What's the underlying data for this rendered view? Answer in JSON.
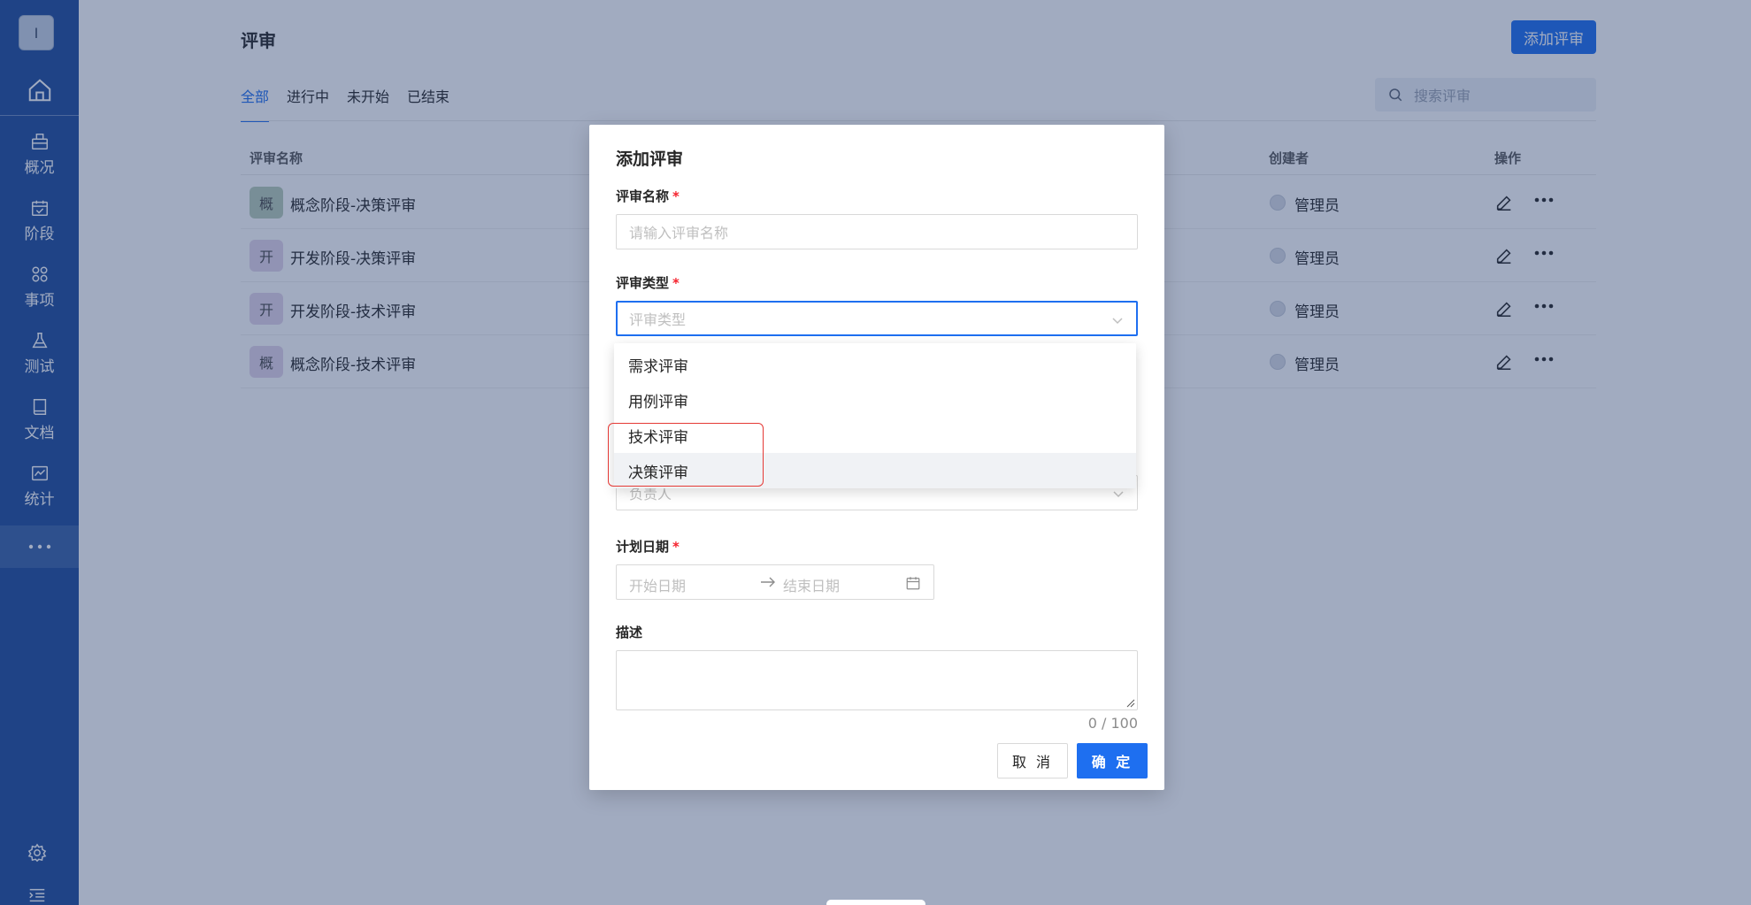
{
  "sidebar": {
    "avatar_text": "I",
    "items": [
      {
        "label": "概况",
        "icon": "briefcase-icon"
      },
      {
        "label": "阶段",
        "icon": "calendar-check-icon"
      },
      {
        "label": "事项",
        "icon": "items-icon"
      },
      {
        "label": "测试",
        "icon": "flask-icon"
      },
      {
        "label": "文档",
        "icon": "book-icon"
      },
      {
        "label": "统计",
        "icon": "chart-icon"
      }
    ]
  },
  "page": {
    "title": "评审",
    "add_button": "添加评审",
    "tabs": [
      {
        "label": "全部",
        "active": true
      },
      {
        "label": "进行中",
        "active": false
      },
      {
        "label": "未开始",
        "active": false
      },
      {
        "label": "已结束",
        "active": false
      }
    ],
    "search_placeholder": "搜索评审"
  },
  "table": {
    "columns": {
      "name": "评审名称",
      "creator": "创建者",
      "actions": "操作"
    },
    "rows": [
      {
        "badge": "概",
        "badge_color": "#b9cdb9",
        "name": "概念阶段-决策评审",
        "creator": "管理员"
      },
      {
        "badge": "开",
        "badge_color": "#e3d6ea",
        "name": "开发阶段-决策评审",
        "creator": "管理员"
      },
      {
        "badge": "开",
        "badge_color": "#e3d6ea",
        "name": "开发阶段-技术评审",
        "creator": "管理员"
      },
      {
        "badge": "概",
        "badge_color": "#e3d6ea",
        "name": "概念阶段-技术评审",
        "creator": "管理员"
      }
    ]
  },
  "modal": {
    "title": "添加评审",
    "name_label": "评审名称",
    "name_placeholder": "请输入评审名称",
    "type_label": "评审类型",
    "type_placeholder": "评审类型",
    "owner_placeholder": "负责人",
    "date_label": "计划日期",
    "date_start_placeholder": "开始日期",
    "date_end_placeholder": "结束日期",
    "desc_label": "描述",
    "desc_counter": "0 / 100",
    "cancel_label": "取 消",
    "ok_label": "确 定"
  },
  "dropdown": {
    "options": [
      "需求评审",
      "用例评审",
      "技术评审",
      "决策评审"
    ],
    "hovered_index": 3
  },
  "colors": {
    "primary": "#1e6ff0",
    "sidebar": "#1f4d9b",
    "required": "#f5222d",
    "annotation": "#e53935"
  }
}
